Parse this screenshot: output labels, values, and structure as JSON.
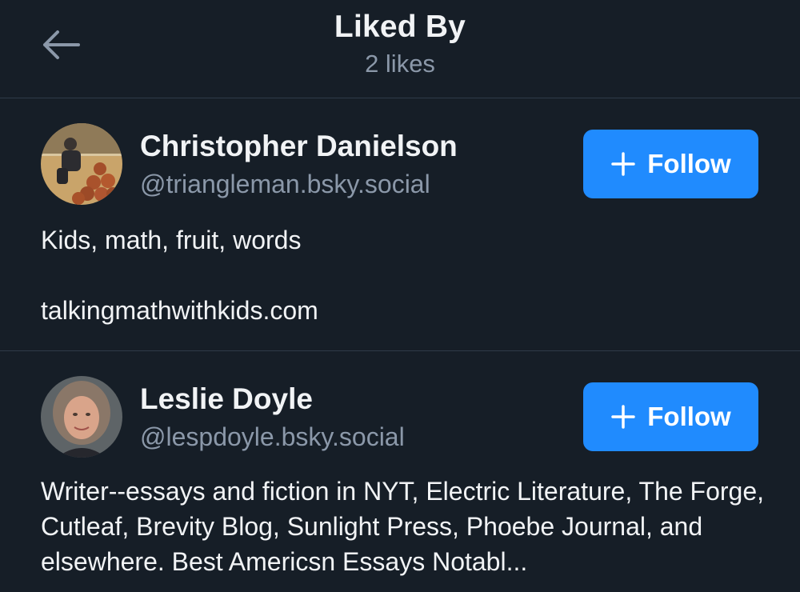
{
  "header": {
    "title": "Liked By",
    "subtitle": "2 likes"
  },
  "users": [
    {
      "name": "Christopher Danielson",
      "handle": "@triangleman.bsky.social",
      "follow_label": "Follow",
      "bio_line1": "Kids, math, fruit, words",
      "bio_line2": "talkingmathwithkids.com"
    },
    {
      "name": "Leslie Doyle",
      "handle": "@lespdoyle.bsky.social",
      "follow_label": "Follow",
      "bio": "Writer--essays and fiction in NYT, Electric Literature, The Forge, Cutleaf, Brevity Blog, Sunlight Press, Phoebe Journal, and elsewhere. Best Americsn Essays Notabl..."
    }
  ],
  "colors": {
    "background": "#161e27",
    "accent": "#208bfe",
    "muted_text": "#8b98a9",
    "divider": "#2e3a48"
  }
}
